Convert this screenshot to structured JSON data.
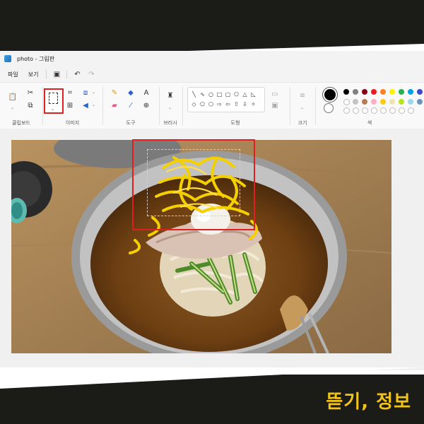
{
  "window": {
    "title": "photo - 그림판"
  },
  "menu": {
    "file": "파일",
    "view": "보기",
    "save_icon": "save-icon",
    "undo_icon": "undo-icon",
    "redo_icon": "redo-icon"
  },
  "ribbon": {
    "groups": {
      "clipboard": "클립보드",
      "image": "이미지",
      "tools": "도구",
      "brushes": "브러시",
      "shapes": "도형",
      "size": "크기",
      "colors": "색"
    }
  },
  "palette": {
    "primary": "#000000",
    "secondary": "#ffffff",
    "row1": [
      "#000000",
      "#7f7f7f",
      "#880015",
      "#ed1c24",
      "#ff7f27",
      "#fff200",
      "#22b14c",
      "#00a2e8",
      "#3f48cc",
      "#a349a4"
    ],
    "row2": [
      "#ffffff",
      "#c3c3c3",
      "#b97a57",
      "#ffaec9",
      "#ffc90e",
      "#efe4b0",
      "#b5e61d",
      "#99d9ea",
      "#7092be",
      "#c8bfe7"
    ]
  },
  "brand": {
    "text": "뜯기, 정보"
  }
}
